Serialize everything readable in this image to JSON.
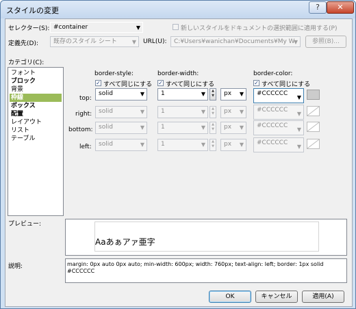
{
  "window": {
    "title": "スタイルの変更",
    "help_glyph": "?",
    "close_glyph": "✕"
  },
  "selector": {
    "label": "セレクター(S):",
    "value": "#container"
  },
  "apply_selection": {
    "label": "新しいスタイルをドキュメントの選択範囲に適用する(P)",
    "checked": false
  },
  "define_in": {
    "label": "定義先(D):",
    "value": "既存のスタイル シート"
  },
  "url": {
    "label": "URL(U):",
    "value": "C:¥Users¥wanichan¥Documents¥My W",
    "browse_label": "参照(B)..."
  },
  "categories": {
    "label": "カテゴリ(C):",
    "items": [
      "フォント",
      "ブロック",
      "背景",
      "枠線",
      "ボックス",
      "配置",
      "レイアウト",
      "リスト",
      "テーブル"
    ],
    "selected": "枠線"
  },
  "border": {
    "style_header": "border-style:",
    "width_header": "border-width:",
    "color_header": "border-color:",
    "same_label": "すべて同じにする",
    "rows": [
      {
        "label": "top:",
        "style": "solid",
        "width": "1",
        "unit": "px",
        "color": "#CCCCCC"
      },
      {
        "label": "right:",
        "style": "solid",
        "width": "1",
        "unit": "px",
        "color": "#CCCCCC"
      },
      {
        "label": "bottom:",
        "style": "solid",
        "width": "1",
        "unit": "px",
        "color": "#CCCCCC"
      },
      {
        "label": "left:",
        "style": "solid",
        "width": "1",
        "unit": "px",
        "color": "#CCCCCC"
      }
    ]
  },
  "preview": {
    "label": "プレビュー:",
    "sample": "Aaあぁアァ亜字"
  },
  "description": {
    "label": "説明:",
    "text": "margin: 0px auto 0px auto; min-width: 600px; width: 760px; text-align: left; border: 1px solid #CCCCCC"
  },
  "buttons": {
    "ok": "OK",
    "cancel": "キャンセル",
    "apply": "適用(A)"
  },
  "colors": {
    "selected_category": "#9bbb59",
    "swatch": "#cccccc",
    "title_bar": "#c4d7ee"
  }
}
